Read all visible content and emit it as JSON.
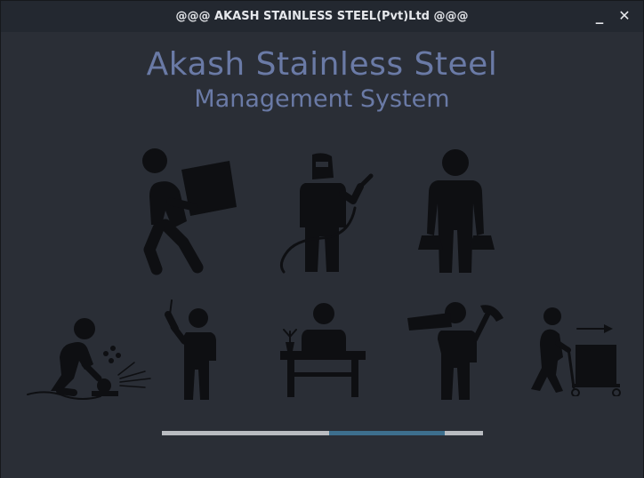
{
  "window": {
    "title": "@@@ AKASH STAINLESS STEEL(Pvt)Ltd @@@",
    "minimize_glyph": "_",
    "close_glyph": "✕"
  },
  "splash": {
    "heading": "Akash Stainless Steel",
    "subheading": "Management System",
    "heading_color": "#6a7aa6",
    "figure_color": "#0e0f12",
    "illustrations": [
      "worker-carrying-box-icon",
      "welder-icon",
      "shopper-with-bags-icon",
      "grinder-worker-icon",
      "driller-icon",
      "desk-worker-icon",
      "lumber-and-hammer-worker-icon",
      "cart-pusher-icon"
    ]
  },
  "progress": {
    "track_color": "#b9bcc1",
    "fill_color": "#3d6f8e",
    "fill_start_fraction": 0.52,
    "fill_end_fraction": 0.88
  }
}
